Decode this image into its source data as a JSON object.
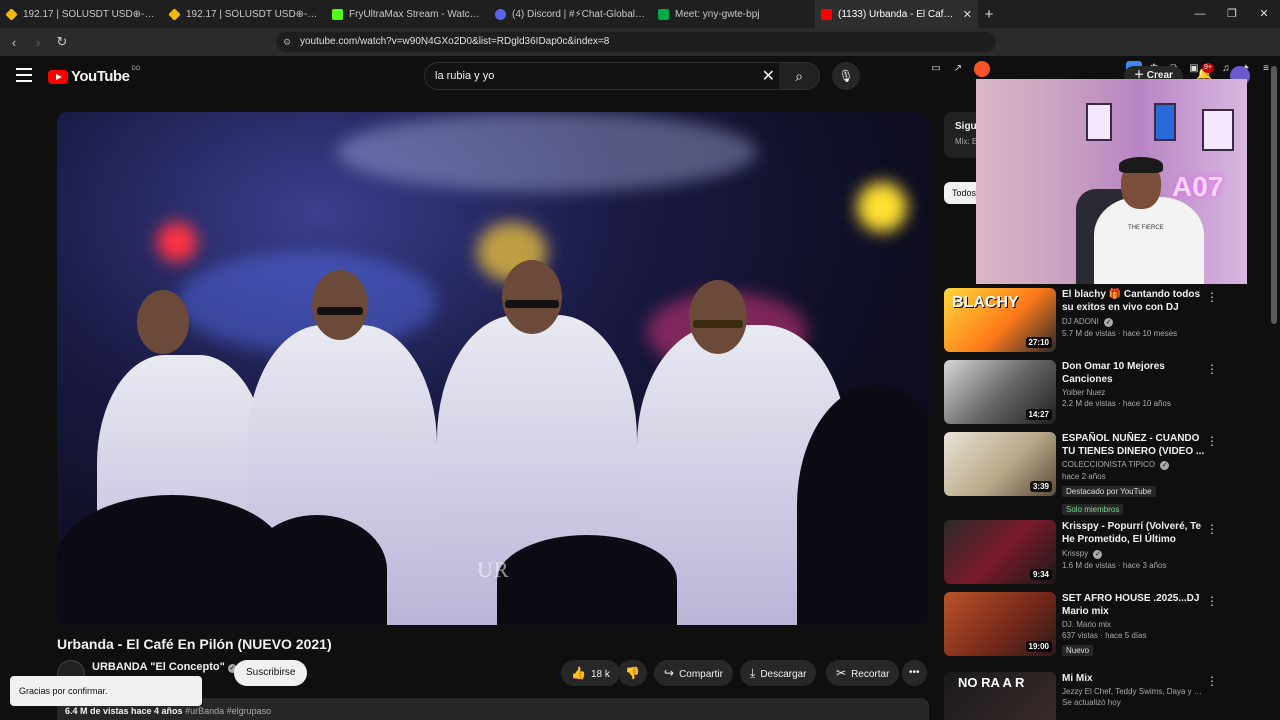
{
  "browser": {
    "tabs": [
      {
        "title": "192.17 | SOLUSDT USD⊕-Margined P",
        "color": "#f0b90b"
      },
      {
        "title": "192.17 | SOLUSDT USD⊕-Margined P",
        "color": "#f0b90b"
      },
      {
        "title": "FryUltraMax Stream - Watch Live",
        "color": "#53fc18"
      },
      {
        "title": "(4) Discord | #⚡Chat-Global | A",
        "color": "#5865f2"
      },
      {
        "title": "Meet: yny-gwte-bpj",
        "color": "#00ac47"
      },
      {
        "title": "(1133) Urbanda - El Café En P",
        "color": "#ff0000"
      }
    ],
    "url": "youtube.com/watch?v=w90N4GXo2D0&list=RDgld36IDap0c&index=8"
  },
  "header": {
    "logo_text": "YouTube",
    "country_code": "DO",
    "search_query": "la rubia y yo",
    "create_label": "Crear",
    "notif_count": "9+"
  },
  "video": {
    "title": "Urbanda - El Café En Pilón (NUEVO 2021)",
    "watermark": "UR",
    "channel": "URBANDA \"El Concepto\"",
    "subscribe_label": "Suscribirse",
    "likes": "18 k",
    "share_label": "Compartir",
    "download_label": "Descargar",
    "clip_label": "Recortar",
    "description": "6.4 M de vistas  hace 4 años",
    "hashtags": "#urBanda #elgrupaso"
  },
  "toast": "Gracias por confirmar.",
  "queue": {
    "title": "Sigui",
    "subtitle": "Mix: E"
  },
  "chip_all": "Todos",
  "webcam": {
    "neon_text": "A07",
    "shirt_text": "THE FIERCE"
  },
  "recommendations": [
    {
      "title": "El blachy 🎁 Cantando todos su exitos en vivo con DJ ADONI ( ...",
      "channel": "DJ ADONI",
      "verified": true,
      "meta": "5.7 M de vistas · hace 10 meses",
      "duration": "27:10",
      "thumb_text": "BLACHY"
    },
    {
      "title": "Don Omar 10 Mejores Canciones",
      "channel": "Yoiber Nuez",
      "verified": false,
      "meta": "2.2 M de vistas · hace 10 años",
      "duration": "14:27",
      "thumb_text": ""
    },
    {
      "title": "ESPAÑOL NUÑEZ - CUANDO TU TIENES DINERO (VIDEO ...",
      "channel": "COLECCIONISTA TIPICO",
      "verified": true,
      "meta": "hace 2 años",
      "duration": "3:39",
      "tag1": "Destacado por YouTube",
      "tag2": "Solo miembros",
      "thumb_text": ""
    },
    {
      "title": "Krisspy - Popurrí (Volveré, Te He Prometido, El Último Beso)...",
      "channel": "Krisspy",
      "verified": true,
      "meta": "1.6 M de vistas · hace 3 años",
      "duration": "9:34",
      "thumb_text": ""
    },
    {
      "title": "SET AFRO HOUSE .2025...DJ Mario mix",
      "channel": "DJ. Mario mix",
      "verified": false,
      "meta": "637 vistas · hace 5 días",
      "duration": "19:00",
      "tag1": "Nuevo",
      "thumb_text": ""
    },
    {
      "title": "Mi Mix",
      "channel": "Jezzy El Chef, Teddy Swims, Daya y muc...",
      "verified": false,
      "meta": "Se actualizó hoy",
      "duration": "",
      "thumb_text": "NO RA A R"
    }
  ]
}
